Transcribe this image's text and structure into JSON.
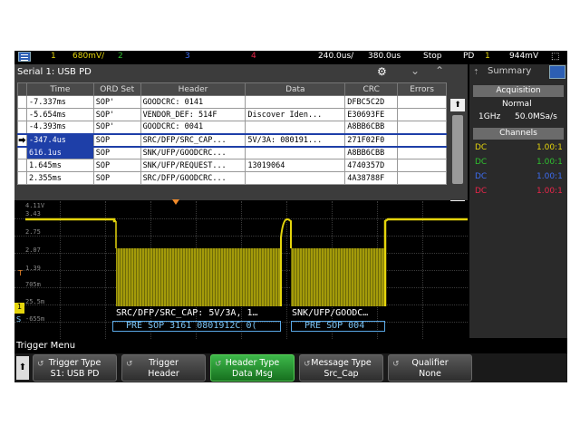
{
  "status_bar": {
    "ch1_num": "1",
    "ch1_scale": "680mV/",
    "ch2_num": "2",
    "ch3_num": "3",
    "ch4_num": "4",
    "timebase": "240.0us/",
    "delay": "380.0us",
    "run_state": "Stop",
    "trig_source": "PD",
    "trig_ch": "1",
    "trig_level": "944mV",
    "colors": {
      "ch1": "#e4d40c",
      "ch2": "#2fbf2f",
      "ch3": "#3d6cf0",
      "ch4": "#e8264a"
    }
  },
  "serial": {
    "title": "Serial 1: USB PD",
    "icons": [
      "gear-icon",
      "chevron-down-icon",
      "chevron-up-icon"
    ],
    "columns": [
      "Time",
      "ORD Set",
      "Header",
      "Data",
      "CRC",
      "Errors"
    ],
    "rows": [
      {
        "marker": "",
        "time": "-7.337ms",
        "ord": "SOP'",
        "header": "GOODCRC: 0141",
        "data": "",
        "crc": "DFBC5C2D",
        "errors": ""
      },
      {
        "marker": "",
        "time": "-5.654ms",
        "ord": "SOP'",
        "header": "VENDOR_DEF: 514F",
        "data": "Discover Iden...",
        "crc": "E30693FE",
        "errors": ""
      },
      {
        "marker": "",
        "time": "-4.393ms",
        "ord": "SOP'",
        "header": "GOODCRC: 0041",
        "data": "",
        "crc": "A8BB6CBB",
        "errors": ""
      },
      {
        "marker": "⮕",
        "time": "-347.4us",
        "ord": "SOP",
        "header": "SRC/DFP/SRC_CAP...",
        "data": "5V/3A: 080191...",
        "crc": "271F02F0",
        "errors": ""
      },
      {
        "marker": "",
        "time": "616.1us",
        "ord": "SOP",
        "header": "SNK/UFP/GOODCRC...",
        "data": "",
        "crc": "A8BB6CBB",
        "errors": ""
      },
      {
        "marker": "",
        "time": "1.645ms",
        "ord": "SOP",
        "header": "SNK/UFP/REQUEST...",
        "data": "13019064",
        "crc": "4740357D",
        "errors": ""
      },
      {
        "marker": "",
        "time": "2.355ms",
        "ord": "SOP",
        "header": "SRC/DFP/GOODCRC...",
        "data": "",
        "crc": "4A38788F",
        "errors": ""
      }
    ],
    "scroll_up": "⬆",
    "scroll_down": "⬇"
  },
  "waveform": {
    "y_labels": [
      "4.11V",
      "3.43",
      "2.75",
      "2.07",
      "1.39",
      "705m",
      "25.5m",
      "-655m"
    ],
    "ground_marker": "1",
    "trigger_marker": "T",
    "scroll_marker": "S",
    "decode_text_1": "SRC/DFP/SRC_CAP: 5V/3A, 1…",
    "decode_text_2": "SNK/UFP/GOODC…",
    "bus_text_1": "PRE SOP 3161 0801912C 0(",
    "bus_text_2": "PRE SOP 004"
  },
  "side_panel": {
    "tab_label": "Summary",
    "acquisition_header": "Acquisition",
    "mode": "Normal",
    "bandwidth": "1GHz",
    "sample_rate": "50.0MSa/s",
    "channels_header": "Channels",
    "channels": [
      {
        "coupling": "DC",
        "ratio": "1.00:1",
        "color": "#e4d40c"
      },
      {
        "coupling": "DC",
        "ratio": "1.00:1",
        "color": "#2fbf2f"
      },
      {
        "coupling": "DC",
        "ratio": "1.00:1",
        "color": "#3d6cf0"
      },
      {
        "coupling": "DC",
        "ratio": "1.00:1",
        "color": "#e8264a"
      }
    ]
  },
  "trigger_menu": {
    "title": "Trigger Menu",
    "back_icon": "back-arrow-icon",
    "softkeys": [
      {
        "label": "Trigger Type",
        "value": "S1: USB PD",
        "active": false
      },
      {
        "label": "Trigger",
        "value": "Header",
        "active": false
      },
      {
        "label": "Header Type",
        "value": "Data Msg",
        "active": true
      },
      {
        "label": "Message Type",
        "value": "Src_Cap",
        "active": false
      },
      {
        "label": "Qualifier",
        "value": "None",
        "active": false
      }
    ]
  }
}
